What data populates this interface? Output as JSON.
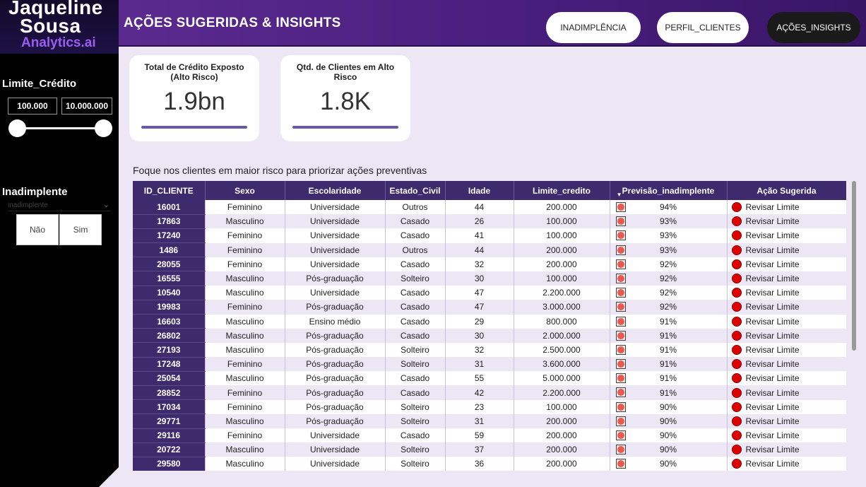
{
  "logo": {
    "line1": "Jaqueline",
    "line2": "Sousa",
    "line3": "Analytics.ai"
  },
  "sidebar": {
    "limite_title": "Limite_Crédito",
    "range_min": "100.000",
    "range_max": "10.000.000",
    "inad_title": "Inadimplente",
    "inad_dropdown_value": "inadimplente",
    "inad_options": [
      "Não",
      "Sim"
    ]
  },
  "header": {
    "title": "AÇÕES SUGERIDAS & INSIGHTS",
    "nav": [
      "INADIMPLÊNCIA",
      "PERFIL_CLIENTES",
      "AÇÕES_INSIGHTS"
    ],
    "active_nav": "AÇÕES_INSIGHTS"
  },
  "kpis": {
    "credit_label": "Total de Crédito Exposto (Alto Risco)",
    "credit_value": "1.9bn",
    "clients_label": "Qtd. de Clientes em Alto Risco",
    "clients_value": "1.8K"
  },
  "table": {
    "caption": "Foque nos clientes em maior risco para priorizar ações preventivas",
    "columns": [
      "ID_CLIENTE",
      "Sexo",
      "Escolaridade",
      "Estado_Civil",
      "Idade",
      "Limite_credito",
      "Previsão_inadimplente",
      "Ação Sugerida"
    ],
    "rows": [
      [
        "16001",
        "Feminino",
        "Universidade",
        "Outros",
        "44",
        "200.000",
        "94%",
        "Revisar Limite"
      ],
      [
        "17863",
        "Masculino",
        "Universidade",
        "Casado",
        "26",
        "100.000",
        "93%",
        "Revisar Limite"
      ],
      [
        "17240",
        "Feminino",
        "Universidade",
        "Casado",
        "41",
        "100.000",
        "93%",
        "Revisar Limite"
      ],
      [
        "1486",
        "Feminino",
        "Universidade",
        "Outros",
        "44",
        "200.000",
        "93%",
        "Revisar Limite"
      ],
      [
        "28055",
        "Feminino",
        "Universidade",
        "Casado",
        "32",
        "200.000",
        "92%",
        "Revisar Limite"
      ],
      [
        "16555",
        "Masculino",
        "Pós-graduação",
        "Solteiro",
        "30",
        "100.000",
        "92%",
        "Revisar Limite"
      ],
      [
        "10540",
        "Masculino",
        "Universidade",
        "Casado",
        "47",
        "2.200.000",
        "92%",
        "Revisar Limite"
      ],
      [
        "19983",
        "Feminino",
        "Pós-graduação",
        "Casado",
        "47",
        "3.000.000",
        "92%",
        "Revisar Limite"
      ],
      [
        "16603",
        "Masculino",
        "Ensino médio",
        "Casado",
        "29",
        "800.000",
        "91%",
        "Revisar Limite"
      ],
      [
        "26802",
        "Masculino",
        "Pós-graduação",
        "Casado",
        "30",
        "2.000.000",
        "91%",
        "Revisar Limite"
      ],
      [
        "27193",
        "Masculino",
        "Pós-graduação",
        "Solteiro",
        "32",
        "2.500.000",
        "91%",
        "Revisar Limite"
      ],
      [
        "17248",
        "Feminino",
        "Pós-graduação",
        "Solteiro",
        "31",
        "3.600.000",
        "91%",
        "Revisar Limite"
      ],
      [
        "25054",
        "Masculino",
        "Pós-graduação",
        "Casado",
        "55",
        "5.000.000",
        "91%",
        "Revisar Limite"
      ],
      [
        "28852",
        "Feminino",
        "Pós-graduação",
        "Casado",
        "42",
        "2.200.000",
        "91%",
        "Revisar Limite"
      ],
      [
        "17034",
        "Feminino",
        "Pós-graduação",
        "Solteiro",
        "23",
        "100.000",
        "90%",
        "Revisar Limite"
      ],
      [
        "29771",
        "Masculino",
        "Pós-graduação",
        "Solteiro",
        "31",
        "200.000",
        "90%",
        "Revisar Limite"
      ],
      [
        "29116",
        "Feminino",
        "Universidade",
        "Casado",
        "59",
        "200.000",
        "90%",
        "Revisar Limite"
      ],
      [
        "20722",
        "Masculino",
        "Universidade",
        "Solteiro",
        "37",
        "200.000",
        "90%",
        "Revisar Limite"
      ],
      [
        "29580",
        "Masculino",
        "Universidade",
        "Solteiro",
        "36",
        "200.000",
        "90%",
        "Revisar Limite"
      ]
    ]
  },
  "colors": {
    "header_purple": "#5b2a8f",
    "table_header": "#3f2a6e",
    "alert_red": "#d00",
    "page_bg": "#ede6f5"
  },
  "icons": {
    "previsao_indicator": "red-circle-square-icon",
    "acao_indicator": "red-dot-icon",
    "dropdown": "chevron-down-icon",
    "sort": "sort-down-icon"
  }
}
